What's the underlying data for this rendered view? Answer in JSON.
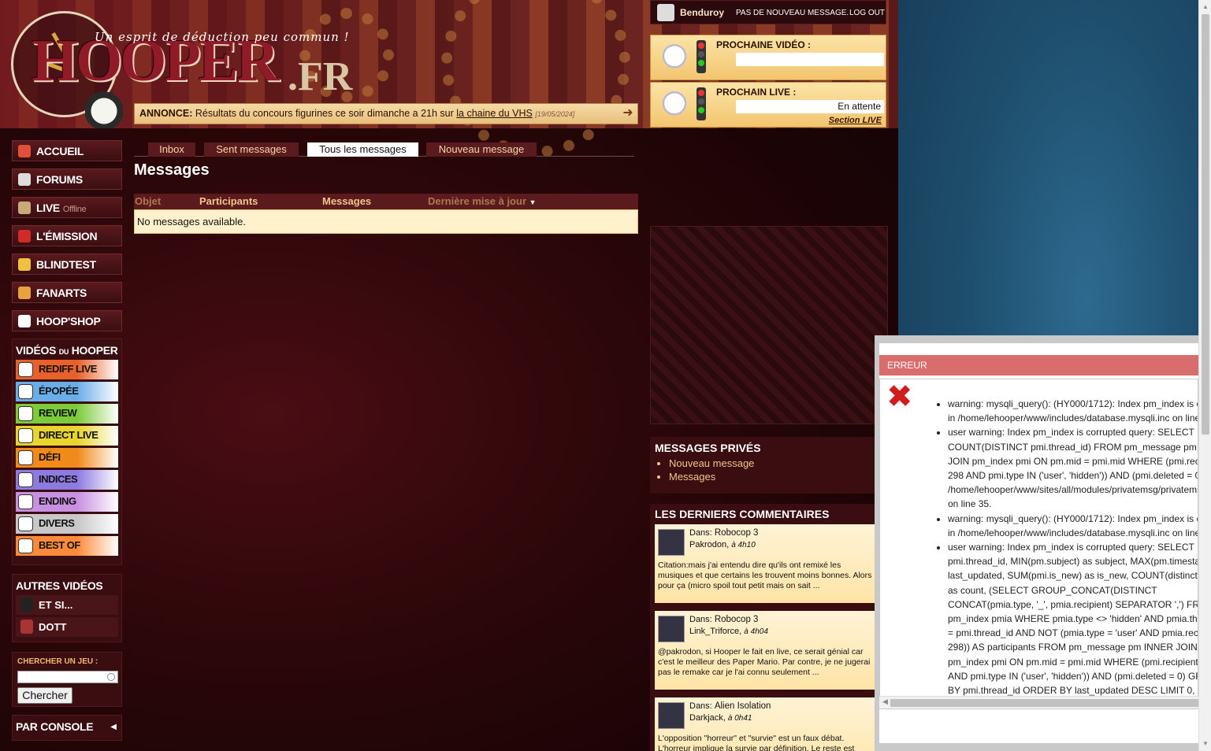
{
  "header": {
    "logo_main": "HOOPER",
    "logo_suffix": ".FR",
    "slogan": "Un esprit de déduction peu commun !",
    "announce_label": "ANNONCE:",
    "announce_text": "Résultats du concours figurines ce soir dimanche a 21h sur",
    "announce_link": "la chaine du VHS",
    "announce_date": "[19/05/2024]"
  },
  "userbar": {
    "username": "Benduroy",
    "pm_status": "PAS DE NOUVEAU MESSAGE.",
    "logout": "LOG OUT"
  },
  "next": {
    "video_title": "PROCHAINE VIDÉO :",
    "video_value": "",
    "live_title": "PROCHAIN LIVE :",
    "live_value": "En attente",
    "live_link": "Section LIVE"
  },
  "nav": {
    "items": [
      {
        "label": "ACCUEIL",
        "sub": ""
      },
      {
        "label": "FORUMS",
        "sub": ""
      },
      {
        "label": "LIVE",
        "sub": "Offline"
      },
      {
        "label": "L'ÉMISSION",
        "sub": ""
      },
      {
        "label": "BLINDTEST",
        "sub": ""
      },
      {
        "label": "FANARTS",
        "sub": ""
      },
      {
        "label": "HOOP'SHOP",
        "sub": ""
      }
    ]
  },
  "videos": {
    "title_a": "VIDÉOS",
    "title_du": "DU",
    "title_b": "HOOPER",
    "items": [
      "REDIFF LIVE",
      "ÉPOPÉE",
      "REVIEW",
      "DIRECT LIVE",
      "DÉFI",
      "INDICES",
      "ENDING",
      "DIVERS",
      "BEST OF"
    ],
    "colors": [
      "#e8602a",
      "#6aaee8",
      "#7ccc3a",
      "#e8d42a",
      "#f08a1a",
      "#8e7ae0",
      "#c890e0",
      "#c8c8c8",
      "#ff8a3a"
    ]
  },
  "others": {
    "title": "AUTRES VIDÉOS",
    "items": [
      "ET SI...",
      "DOTT"
    ]
  },
  "search": {
    "label": "CHERCHER UN JEU :",
    "button": "Chercher"
  },
  "console": {
    "label": "PAR CONSOLE"
  },
  "tabs": [
    "Inbox",
    "Sent messages",
    "Tous les messages",
    "Nouveau message"
  ],
  "page_title": "Messages",
  "table": {
    "headers": [
      "Objet",
      "Participants",
      "Messages",
      "Dernière mise à jour"
    ],
    "empty": "No messages available."
  },
  "pm_panel": {
    "title": "MESSAGES PRIVÉS",
    "links": [
      "Nouveau message",
      "Messages"
    ]
  },
  "comments": {
    "title": "LES DERNIERS COMMENTAIRES",
    "items": [
      {
        "dans": "Dans:",
        "topic": "Robocop 3",
        "author": "Pakrodon,",
        "time": "à 4h10",
        "text": "Citation:mais j'ai entendu dire qu'ils ont remixé les musiques et que certains les trouvent moins bonnes. Alors pour ça (micro spoil tout petit mais on sait ..."
      },
      {
        "dans": "Dans:",
        "topic": "Robocop 3",
        "author": "Link_Triforce,",
        "time": "à 4h04",
        "text": "@pakrodon, si Hooper le fait en live, ce serait génial car c'est le meilleur des Paper Mario. Par contre, je ne jugerai pas le remake car je l'ai connu seulement ..."
      },
      {
        "dans": "Dans:",
        "topic": "Alien Isolation",
        "author": "Darkjack,",
        "time": "à 0h41",
        "text": "L'opposition \"horreur\" et \"survie\" est un faux débat. L'horreur implique la survie par définition. Le reste est"
      }
    ]
  },
  "error": {
    "title": "ERREUR",
    "lines": [
      "warning: mysqli_query(): (HY000/1712): Index pm_index is c in /home/lehooper/www/includes/database.mysqli.inc on line",
      "user warning: Index pm_index is corrupted query: SELECT COUNT(DISTINCT pmi.thread_id) FROM pm_message pm JOIN pm_index pmi ON pm.mid = pmi.mid WHERE (pmi.reci 298 AND pmi.type IN ('user', 'hidden')) AND (pmi.deleted = 0 /home/lehooper/www/sites/all/modules/privatemsg/privatems on line 35.",
      "warning: mysqli_query(): (HY000/1712): Index pm_index is c in /home/lehooper/www/includes/database.mysqli.inc on line",
      "user warning: Index pm_index is corrupted query: SELECT pmi.thread_id, MIN(pm.subject) as subject, MAX(pm.timesta last_updated, SUM(pmi.is_new) as is_new, COUNT(distinct as count, (SELECT GROUP_CONCAT(DISTINCT CONCAT(pmia.type, '_', pmia.recipient) SEPARATOR ',') FR pm_index pmia WHERE pmia.type <> 'hidden' AND pmia.thr = pmi.thread_id AND NOT (pmia.type = 'user' AND pmia.rec 298)) AS participants FROM pm_message pm INNER JOIN pm_index pmi ON pm.mid = pmi.mid WHERE (pmi.recipient AND pmi.type IN ('user', 'hidden')) AND (pmi.deleted = 0) GR BY pmi.thread_id ORDER BY last_updated DESC LIMIT 0, 2"
    ]
  }
}
